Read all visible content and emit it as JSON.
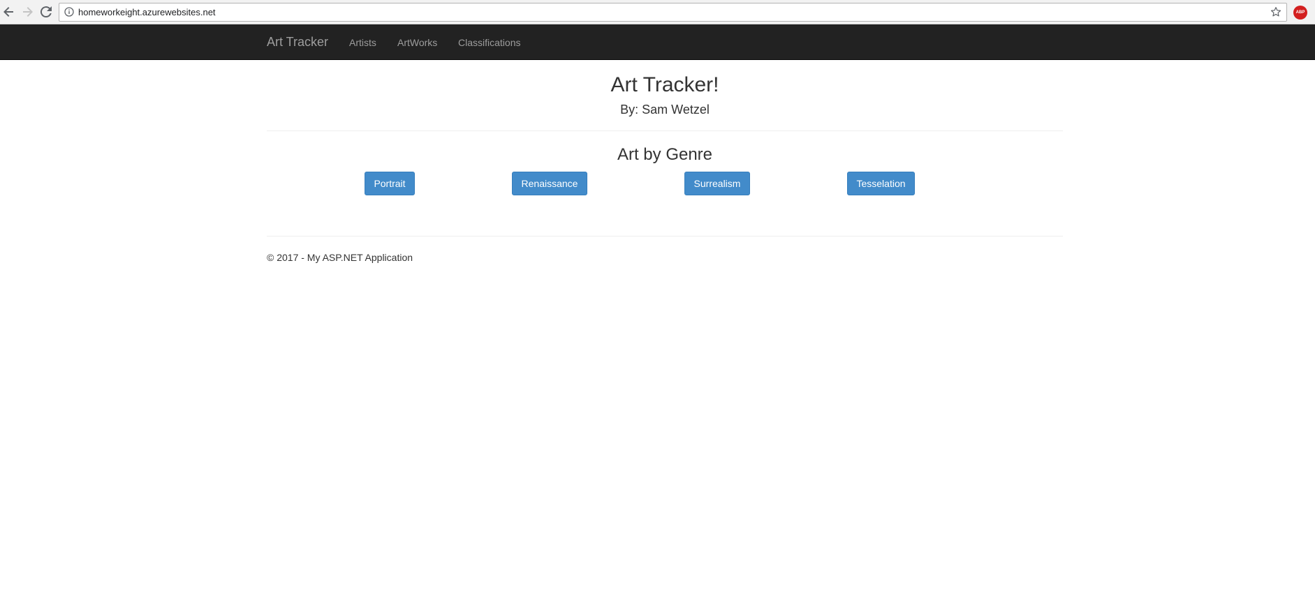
{
  "browser": {
    "url": "homeworkeight.azurewebsites.net",
    "extension_badge": "ABP"
  },
  "navbar": {
    "brand": "Art Tracker",
    "links": [
      "Artists",
      "ArtWorks",
      "Classifications"
    ]
  },
  "main": {
    "title": "Art Tracker!",
    "byline": "By: Sam Wetzel",
    "section_title": "Art by Genre",
    "genre_buttons": [
      "Portrait",
      "Renaissance",
      "Surrealism",
      "Tesselation"
    ]
  },
  "footer": {
    "text": "© 2017 - My ASP.NET Application"
  },
  "colors": {
    "navbar_bg": "#222222",
    "nav_text": "#9d9d9d",
    "button_primary": "#428bca"
  }
}
